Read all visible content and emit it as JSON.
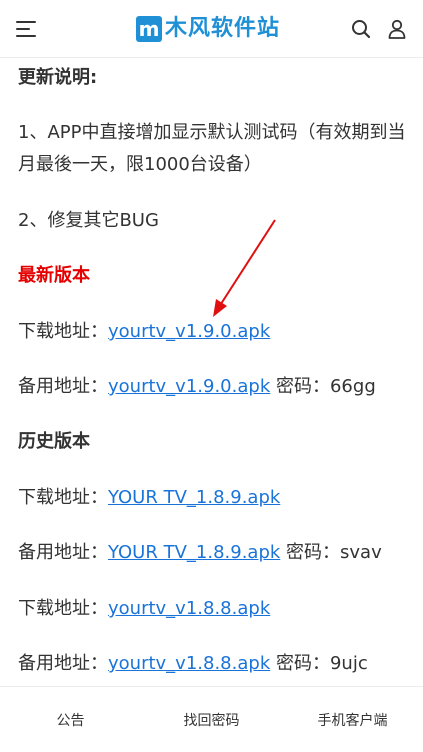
{
  "header": {
    "logo_mark": "m",
    "logo_text": "木风软件站",
    "accent_color": "#1f8fd6",
    "icons": [
      "menu-icon",
      "search-icon",
      "user-icon"
    ]
  },
  "article": {
    "update_heading": "更新说明:",
    "note1": "1、APP中直接增加显示默认测试码（有效期到当月最後一天，限1000台设备）",
    "note2": "2、修复其它BUG",
    "latest_heading": "最新版本",
    "history_heading": "历史版本",
    "download_label": "下载地址：",
    "backup_label": "备用地址：",
    "password_label": "密码：",
    "latest": {
      "download_link": "yourtv_v1.9.0.apk",
      "backup_link": "yourtv_v1.9.0.apk",
      "backup_password": "66gg"
    },
    "history": [
      {
        "download_link": "YOUR TV_1.8.9.apk",
        "backup_link": "YOUR TV_1.8.9.apk",
        "backup_password": "svav"
      },
      {
        "download_link": "yourtv_v1.8.8.apk",
        "backup_link": "yourtv_v1.8.8.apk",
        "backup_password": "9ujc"
      }
    ],
    "link_color": "#1a73d9",
    "highlight_color": "#e60000"
  },
  "bottom_nav": {
    "items": [
      {
        "label": "公告"
      },
      {
        "label": "找回密码"
      },
      {
        "label": "手机客户端"
      }
    ]
  }
}
